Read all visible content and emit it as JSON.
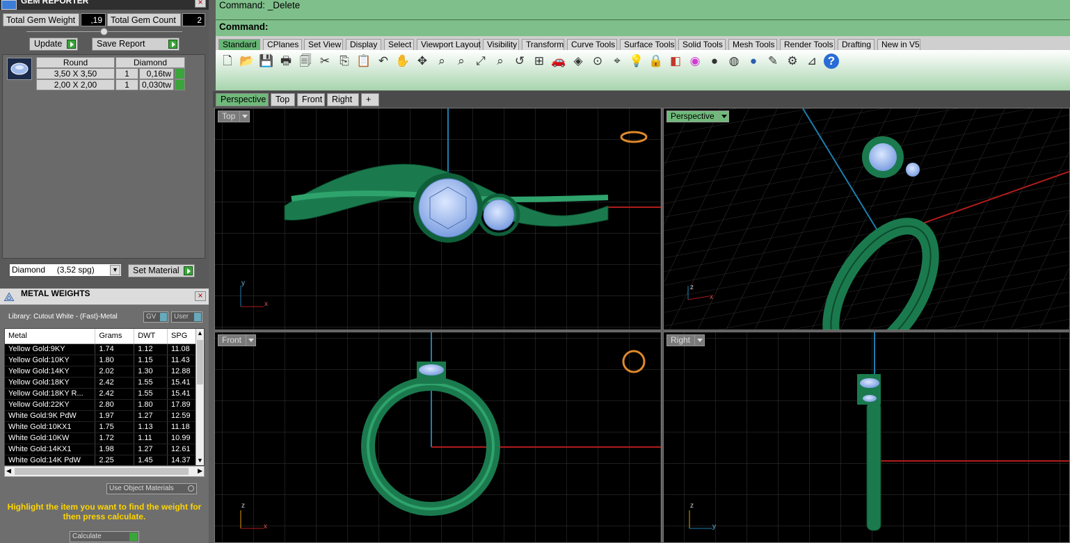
{
  "gem_reporter": {
    "title": "GEM REPORTER",
    "total_weight_label": "Total Gem Weight",
    "total_weight_value": ",19",
    "total_count_label": "Total Gem Count",
    "total_count_value": "2",
    "update_label": "Update",
    "save_report_label": "Save Report",
    "header_cut": "Round",
    "header_material": "Diamond",
    "rows": [
      {
        "size": "3,50 X 3,50",
        "count": "1",
        "weight": "0,16tw"
      },
      {
        "size": "2,00 X 2,00",
        "count": "1",
        "weight": "0,030tw"
      }
    ],
    "material_select": "Diamond     (3,52 spg)",
    "set_material_label": "Set Material"
  },
  "metal_weights": {
    "title": "METAL WEIGHTS",
    "library": "Library: Cutout White - (Fast)-Metal",
    "gv_label": "GV",
    "user_label": "User",
    "columns": [
      "Metal",
      "Grams",
      "DWT",
      "SPG"
    ],
    "rows": [
      [
        "Yellow Gold:9KY",
        "1.74",
        "1.12",
        "11.08"
      ],
      [
        "Yellow Gold:10KY",
        "1.80",
        "1.15",
        "11.43"
      ],
      [
        "Yellow Gold:14KY",
        "2.02",
        "1.30",
        "12.88"
      ],
      [
        "Yellow Gold:18KY",
        "2.42",
        "1.55",
        "15.41"
      ],
      [
        "Yellow Gold:18KY R...",
        "2.42",
        "1.55",
        "15.41"
      ],
      [
        "Yellow Gold:22KY",
        "2.80",
        "1.80",
        "17.89"
      ],
      [
        "White Gold:9K PdW",
        "1.97",
        "1.27",
        "12.59"
      ],
      [
        "White Gold:10KX1",
        "1.75",
        "1.13",
        "11.18"
      ],
      [
        "White Gold:10KW",
        "1.72",
        "1.11",
        "10.99"
      ],
      [
        "White Gold:14KX1",
        "1.98",
        "1.27",
        "12.61"
      ],
      [
        "White Gold:14K PdW",
        "2.25",
        "1.45",
        "14.37"
      ]
    ],
    "use_object_materials": "Use Object Materials",
    "hint": "Highlight the item you want to find the weight for then press calculate.",
    "calculate_label": "Calculate"
  },
  "command": {
    "line1": "Command: _Delete",
    "line2": "Command:"
  },
  "toolbar_tabs": [
    "Standard",
    "CPlanes",
    "Set View",
    "Display",
    "Select",
    "Viewport Layout",
    "Visibility",
    "Transform",
    "Curve Tools",
    "Surface Tools",
    "Solid Tools",
    "Mesh Tools",
    "Render Tools",
    "Drafting",
    "New in V5"
  ],
  "tools": [
    "new-icon",
    "open-icon",
    "save-icon",
    "print-icon",
    "import-icon",
    "cut-icon",
    "copy-icon",
    "paste-icon",
    "undo-icon",
    "pan-icon",
    "rotate-view-icon",
    "zoom-icon",
    "zoom-window-icon",
    "zoom-extents-icon",
    "zoom-selected-icon",
    "undo-view-icon",
    "four-viewports-icon",
    "car-icon",
    "named-view-icon",
    "ortho-icon",
    "snap-icon",
    "lightbulb-icon",
    "lock-icon",
    "layer-icon",
    "color-wheel-icon",
    "shaded-sphere-icon",
    "rendered-sphere-icon",
    "material-sphere-icon",
    "highlighter-icon",
    "options-gear-icon",
    "dimension-icon",
    "help-icon"
  ],
  "viewport_tabs": [
    "Perspective",
    "Top",
    "Front",
    "Right",
    "+"
  ],
  "viewports": {
    "top": "Top",
    "perspective": "Perspective",
    "front": "Front",
    "right": "Right"
  },
  "axes": {
    "y": "y",
    "x": "x",
    "z": "z"
  },
  "colors": {
    "ring": "#1a7a4e",
    "gem": "#a9c8f5",
    "grid": "#3a3a3a",
    "x_axis": "#b01c1c",
    "y_axis": "#1c7fb0",
    "panel_green": "#7fbf8b"
  }
}
